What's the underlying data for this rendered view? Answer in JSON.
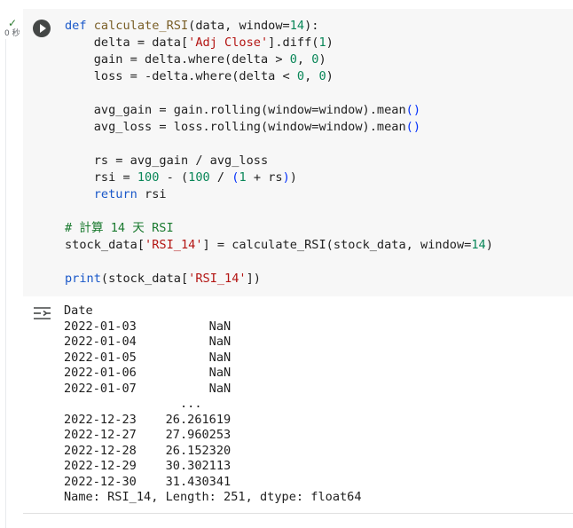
{
  "cell": {
    "status": "✓",
    "exec_time": "0 秒",
    "code_lines": [
      [
        {
          "t": "kw",
          "v": "def"
        },
        {
          "t": "",
          "v": " "
        },
        {
          "t": "fn",
          "v": "calculate_RSI"
        },
        {
          "t": "",
          "v": "(data, window="
        },
        {
          "t": "num",
          "v": "14"
        },
        {
          "t": "",
          "v": "):"
        }
      ],
      [
        {
          "t": "",
          "v": "    delta = data["
        },
        {
          "t": "str",
          "v": "'Adj Close'"
        },
        {
          "t": "",
          "v": "].diff("
        },
        {
          "t": "num",
          "v": "1"
        },
        {
          "t": "",
          "v": ")"
        }
      ],
      [
        {
          "t": "",
          "v": "    gain = delta.where(delta > "
        },
        {
          "t": "num",
          "v": "0"
        },
        {
          "t": "",
          "v": ", "
        },
        {
          "t": "num",
          "v": "0"
        },
        {
          "t": "",
          "v": ")"
        }
      ],
      [
        {
          "t": "",
          "v": "    loss = -delta.where(delta < "
        },
        {
          "t": "num",
          "v": "0"
        },
        {
          "t": "",
          "v": ", "
        },
        {
          "t": "num",
          "v": "0"
        },
        {
          "t": "",
          "v": ")"
        }
      ],
      [],
      [
        {
          "t": "",
          "v": "    avg_gain = gain.rolling(window=window).mean"
        },
        {
          "t": "par",
          "v": "()"
        }
      ],
      [
        {
          "t": "",
          "v": "    avg_loss = loss.rolling(window=window).mean"
        },
        {
          "t": "par",
          "v": "()"
        }
      ],
      [],
      [
        {
          "t": "",
          "v": "    rs = avg_gain / avg_loss"
        }
      ],
      [
        {
          "t": "",
          "v": "    rsi = "
        },
        {
          "t": "num",
          "v": "100"
        },
        {
          "t": "",
          "v": " - ("
        },
        {
          "t": "num",
          "v": "100"
        },
        {
          "t": "",
          "v": " / "
        },
        {
          "t": "par",
          "v": "("
        },
        {
          "t": "num",
          "v": "1"
        },
        {
          "t": "",
          "v": " + rs"
        },
        {
          "t": "par",
          "v": ")"
        },
        {
          "t": "",
          "v": ")"
        }
      ],
      [
        {
          "t": "",
          "v": "    "
        },
        {
          "t": "kw",
          "v": "return"
        },
        {
          "t": "",
          "v": " rsi"
        }
      ],
      [],
      [
        {
          "t": "cm",
          "v": "# 計算 14 天 RSI"
        }
      ],
      [
        {
          "t": "",
          "v": "stock_data["
        },
        {
          "t": "str",
          "v": "'RSI_14'"
        },
        {
          "t": "",
          "v": "] = calculate_RSI(stock_data, window="
        },
        {
          "t": "num",
          "v": "14"
        },
        {
          "t": "",
          "v": ")"
        }
      ],
      [],
      [
        {
          "t": "kw",
          "v": "print"
        },
        {
          "t": "",
          "v": "(stock_data["
        },
        {
          "t": "str",
          "v": "'RSI_14'"
        },
        {
          "t": "",
          "v": "])"
        }
      ]
    ],
    "output_lines": [
      "Date",
      "2022-01-03          NaN",
      "2022-01-04          NaN",
      "2022-01-05          NaN",
      "2022-01-06          NaN",
      "2022-01-07          NaN",
      "                ...    ",
      "2022-12-23    26.261619",
      "2022-12-27    27.960253",
      "2022-12-28    26.152320",
      "2022-12-29    30.302113",
      "2022-12-30    31.430341",
      "Name: RSI_14, Length: 251, dtype: float64"
    ]
  },
  "icons": {
    "run": "play-icon",
    "output": "output-menu-icon",
    "status": "check-icon"
  },
  "colors": {
    "keyword": "#1a58c9",
    "string": "#b31412",
    "number": "#098658",
    "comment": "#1a7a2f",
    "cell_bg": "#f7f7f7"
  }
}
